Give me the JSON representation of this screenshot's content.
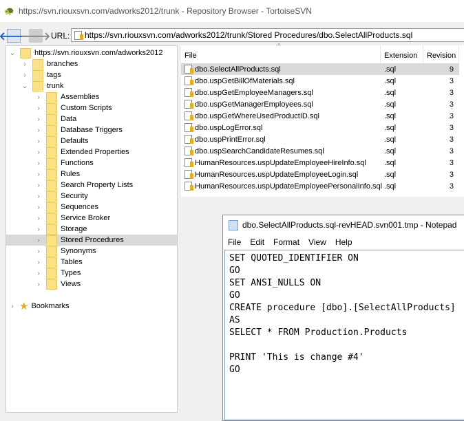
{
  "window": {
    "title": "https://svn.riouxsvn.com/adworks2012/trunk - Repository Browser - TortoiseSVN"
  },
  "toolbar": {
    "url_label": "URL:",
    "url": "https://svn.riouxsvn.com/adworks2012/trunk/Stored Procedures/dbo.SelectAllProducts.sql"
  },
  "tree": {
    "root": "https://svn.riouxsvn.com/adworks2012",
    "top": [
      "branches",
      "tags",
      "trunk"
    ],
    "trunk_children": [
      "Assemblies",
      "Custom Scripts",
      "Data",
      "Database Triggers",
      "Defaults",
      "Extended Properties",
      "Functions",
      "Rules",
      "Search Property Lists",
      "Security",
      "Sequences",
      "Service Broker",
      "Storage",
      "Stored Procedures",
      "Synonyms",
      "Tables",
      "Types",
      "Views"
    ],
    "selected": "Stored Procedures",
    "bookmarks": "Bookmarks"
  },
  "list": {
    "columns": [
      "File",
      "Extension",
      "Revision"
    ],
    "rows": [
      {
        "file": "dbo.SelectAllProducts.sql",
        "ext": ".sql",
        "rev": "9"
      },
      {
        "file": "dbo.uspGetBillOfMaterials.sql",
        "ext": ".sql",
        "rev": "3"
      },
      {
        "file": "dbo.uspGetEmployeeManagers.sql",
        "ext": ".sql",
        "rev": "3"
      },
      {
        "file": "dbo.uspGetManagerEmployees.sql",
        "ext": ".sql",
        "rev": "3"
      },
      {
        "file": "dbo.uspGetWhereUsedProductID.sql",
        "ext": ".sql",
        "rev": "3"
      },
      {
        "file": "dbo.uspLogError.sql",
        "ext": ".sql",
        "rev": "3"
      },
      {
        "file": "dbo.uspPrintError.sql",
        "ext": ".sql",
        "rev": "3"
      },
      {
        "file": "dbo.uspSearchCandidateResumes.sql",
        "ext": ".sql",
        "rev": "3"
      },
      {
        "file": "HumanResources.uspUpdateEmployeeHireInfo.sql",
        "ext": ".sql",
        "rev": "3"
      },
      {
        "file": "HumanResources.uspUpdateEmployeeLogin.sql",
        "ext": ".sql",
        "rev": "3"
      },
      {
        "file": "HumanResources.uspUpdateEmployeePersonalInfo.sql",
        "ext": ".sql",
        "rev": "3"
      }
    ]
  },
  "notepad": {
    "title": "dbo.SelectAllProducts.sql-revHEAD.svn001.tmp - Notepad",
    "menu": [
      "File",
      "Edit",
      "Format",
      "View",
      "Help"
    ],
    "content": "SET QUOTED_IDENTIFIER ON\nGO\nSET ANSI_NULLS ON\nGO\nCREATE procedure [dbo].[SelectAllProducts]\nAS\nSELECT * FROM Production.Products\n\nPRINT 'This is change #4'\nGO"
  }
}
